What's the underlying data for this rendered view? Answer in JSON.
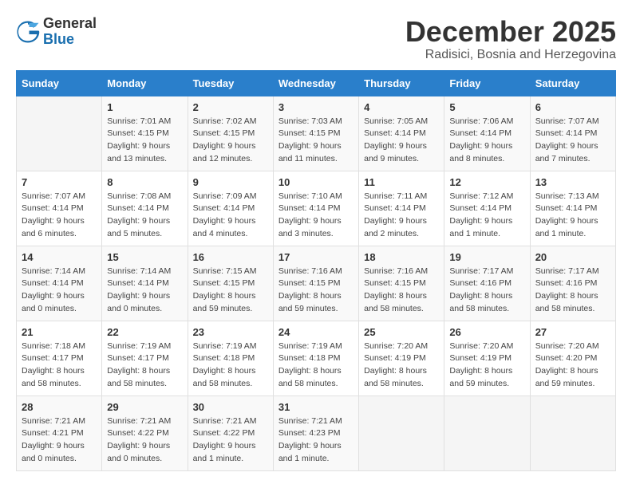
{
  "header": {
    "logo_general": "General",
    "logo_blue": "Blue",
    "title": "December 2025",
    "subtitle": "Radisici, Bosnia and Herzegovina"
  },
  "calendar": {
    "days_of_week": [
      "Sunday",
      "Monday",
      "Tuesday",
      "Wednesday",
      "Thursday",
      "Friday",
      "Saturday"
    ],
    "weeks": [
      [
        {
          "day": "",
          "info": ""
        },
        {
          "day": "1",
          "info": "Sunrise: 7:01 AM\nSunset: 4:15 PM\nDaylight: 9 hours\nand 13 minutes."
        },
        {
          "day": "2",
          "info": "Sunrise: 7:02 AM\nSunset: 4:15 PM\nDaylight: 9 hours\nand 12 minutes."
        },
        {
          "day": "3",
          "info": "Sunrise: 7:03 AM\nSunset: 4:15 PM\nDaylight: 9 hours\nand 11 minutes."
        },
        {
          "day": "4",
          "info": "Sunrise: 7:05 AM\nSunset: 4:14 PM\nDaylight: 9 hours\nand 9 minutes."
        },
        {
          "day": "5",
          "info": "Sunrise: 7:06 AM\nSunset: 4:14 PM\nDaylight: 9 hours\nand 8 minutes."
        },
        {
          "day": "6",
          "info": "Sunrise: 7:07 AM\nSunset: 4:14 PM\nDaylight: 9 hours\nand 7 minutes."
        }
      ],
      [
        {
          "day": "7",
          "info": "Sunrise: 7:07 AM\nSunset: 4:14 PM\nDaylight: 9 hours\nand 6 minutes."
        },
        {
          "day": "8",
          "info": "Sunrise: 7:08 AM\nSunset: 4:14 PM\nDaylight: 9 hours\nand 5 minutes."
        },
        {
          "day": "9",
          "info": "Sunrise: 7:09 AM\nSunset: 4:14 PM\nDaylight: 9 hours\nand 4 minutes."
        },
        {
          "day": "10",
          "info": "Sunrise: 7:10 AM\nSunset: 4:14 PM\nDaylight: 9 hours\nand 3 minutes."
        },
        {
          "day": "11",
          "info": "Sunrise: 7:11 AM\nSunset: 4:14 PM\nDaylight: 9 hours\nand 2 minutes."
        },
        {
          "day": "12",
          "info": "Sunrise: 7:12 AM\nSunset: 4:14 PM\nDaylight: 9 hours\nand 1 minute."
        },
        {
          "day": "13",
          "info": "Sunrise: 7:13 AM\nSunset: 4:14 PM\nDaylight: 9 hours\nand 1 minute."
        }
      ],
      [
        {
          "day": "14",
          "info": "Sunrise: 7:14 AM\nSunset: 4:14 PM\nDaylight: 9 hours\nand 0 minutes."
        },
        {
          "day": "15",
          "info": "Sunrise: 7:14 AM\nSunset: 4:14 PM\nDaylight: 9 hours\nand 0 minutes."
        },
        {
          "day": "16",
          "info": "Sunrise: 7:15 AM\nSunset: 4:15 PM\nDaylight: 8 hours\nand 59 minutes."
        },
        {
          "day": "17",
          "info": "Sunrise: 7:16 AM\nSunset: 4:15 PM\nDaylight: 8 hours\nand 59 minutes."
        },
        {
          "day": "18",
          "info": "Sunrise: 7:16 AM\nSunset: 4:15 PM\nDaylight: 8 hours\nand 58 minutes."
        },
        {
          "day": "19",
          "info": "Sunrise: 7:17 AM\nSunset: 4:16 PM\nDaylight: 8 hours\nand 58 minutes."
        },
        {
          "day": "20",
          "info": "Sunrise: 7:17 AM\nSunset: 4:16 PM\nDaylight: 8 hours\nand 58 minutes."
        }
      ],
      [
        {
          "day": "21",
          "info": "Sunrise: 7:18 AM\nSunset: 4:17 PM\nDaylight: 8 hours\nand 58 minutes."
        },
        {
          "day": "22",
          "info": "Sunrise: 7:19 AM\nSunset: 4:17 PM\nDaylight: 8 hours\nand 58 minutes."
        },
        {
          "day": "23",
          "info": "Sunrise: 7:19 AM\nSunset: 4:18 PM\nDaylight: 8 hours\nand 58 minutes."
        },
        {
          "day": "24",
          "info": "Sunrise: 7:19 AM\nSunset: 4:18 PM\nDaylight: 8 hours\nand 58 minutes."
        },
        {
          "day": "25",
          "info": "Sunrise: 7:20 AM\nSunset: 4:19 PM\nDaylight: 8 hours\nand 58 minutes."
        },
        {
          "day": "26",
          "info": "Sunrise: 7:20 AM\nSunset: 4:19 PM\nDaylight: 8 hours\nand 59 minutes."
        },
        {
          "day": "27",
          "info": "Sunrise: 7:20 AM\nSunset: 4:20 PM\nDaylight: 8 hours\nand 59 minutes."
        }
      ],
      [
        {
          "day": "28",
          "info": "Sunrise: 7:21 AM\nSunset: 4:21 PM\nDaylight: 9 hours\nand 0 minutes."
        },
        {
          "day": "29",
          "info": "Sunrise: 7:21 AM\nSunset: 4:22 PM\nDaylight: 9 hours\nand 0 minutes."
        },
        {
          "day": "30",
          "info": "Sunrise: 7:21 AM\nSunset: 4:22 PM\nDaylight: 9 hours\nand 1 minute."
        },
        {
          "day": "31",
          "info": "Sunrise: 7:21 AM\nSunset: 4:23 PM\nDaylight: 9 hours\nand 1 minute."
        },
        {
          "day": "",
          "info": ""
        },
        {
          "day": "",
          "info": ""
        },
        {
          "day": "",
          "info": ""
        }
      ]
    ]
  }
}
